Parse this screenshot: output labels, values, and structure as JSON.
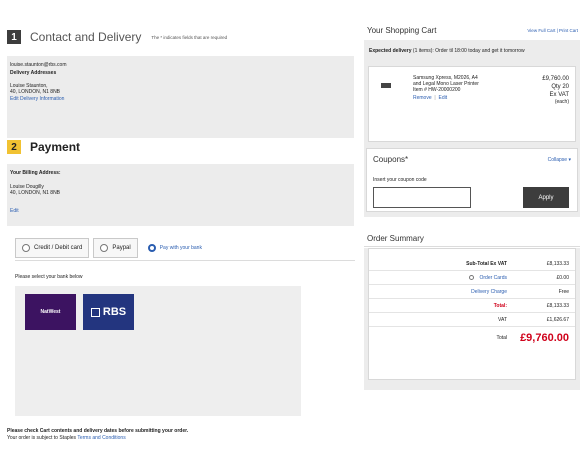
{
  "contact": {
    "step_number": "1",
    "title": "Contact and Delivery",
    "required_note": "The * indicates fields that are required",
    "email": "louise.staunton@rbs.com",
    "delivery_heading": "Delivery Addresses",
    "delivery_name": "Louise Staunton,",
    "delivery_address": "40, LONDON, N1 8NB",
    "edit_delivery": "Edit Delivery Information"
  },
  "payment": {
    "step_number": "2",
    "title": "Payment",
    "billing_heading": "Your Billing Address:",
    "billing_name": "Louise Dougilly",
    "billing_address": "40, LONDON, N1 8NB",
    "edit": "Edit",
    "tabs": [
      {
        "label": "Credit / Debit card",
        "selected": false
      },
      {
        "label": "Paypal",
        "selected": false
      },
      {
        "label": "Pay with your bank",
        "selected": true
      }
    ],
    "bank_prompt": "Please select your bank below",
    "banks": [
      "NatWest",
      "RBS"
    ]
  },
  "footer": {
    "line1": "Please check Cart contents and delivery dates before submitting your order.",
    "line2_prefix": "Your order is subject to Staples",
    "line2_link": "Terms and Conditions"
  },
  "cart": {
    "title": "Your Shopping Cart",
    "view_links": "View Full Cart | Print Cart",
    "expected_delivery_label": "Expected delivery",
    "expected_delivery_text": "(1 items): Order til 18:00 today and get it tomorrow",
    "product_name_line1": "Samsung Xpress, M2026, A4",
    "product_name_line2": "and Legal Mono Laser Printer",
    "product_name_line3": "Item # HW-20000200",
    "remove": "Remove",
    "edit": "Edit",
    "price": "£9,760.00",
    "qty": "Qty 20",
    "ex_vat": "Ex VAT",
    "each": "(each)"
  },
  "coupons": {
    "title": "Coupons*",
    "collapse": "Collapse",
    "prompt": "Insert your coupon code",
    "input_value": "",
    "apply": "Apply"
  },
  "summary": {
    "title": "Order Summary",
    "rows": [
      {
        "label": "Sub-Total Ex VAT",
        "value": "£8,133.33",
        "label_color": "#222222",
        "value_color": "#222222",
        "bold": true
      },
      {
        "label": "Order Cards",
        "value": "£0.00",
        "label_color": "#2a5db0",
        "value_color": "#222222",
        "bold": false
      },
      {
        "label": "Delivery Charge",
        "value": "Free",
        "label_color": "#2a5db0",
        "value_color": "#222222",
        "bold": false
      },
      {
        "label": "Total:",
        "value": "£8,133.33",
        "label_color": "#d0021b",
        "value_color": "#222222",
        "bold": true
      },
      {
        "label": "VAT",
        "value": "£1,626.67",
        "label_color": "#222222",
        "value_color": "#222222",
        "bold": false
      }
    ],
    "total_label": "Total",
    "total_value": "£9,760.00",
    "total_color": "#d0021b"
  }
}
